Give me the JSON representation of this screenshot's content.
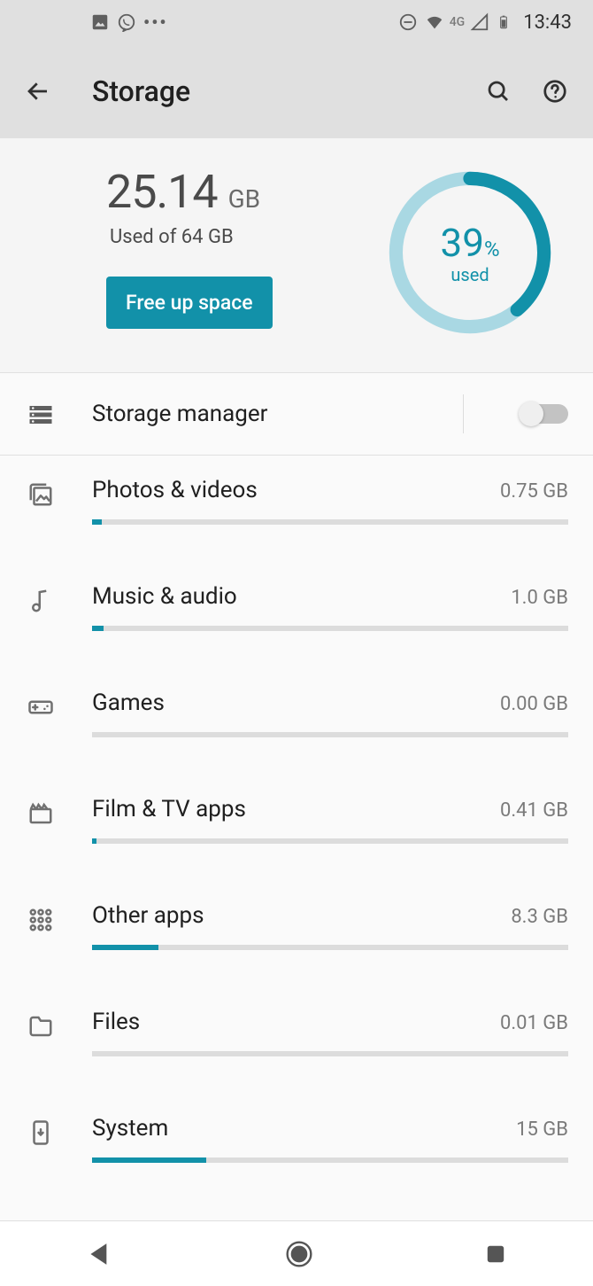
{
  "statusbar": {
    "network_label": "4G",
    "time": "13:43"
  },
  "appbar": {
    "title": "Storage"
  },
  "summary": {
    "used_value": "25.14",
    "used_unit": "GB",
    "used_of": "Used of 64 GB",
    "free_up_label": "Free up space",
    "donut_pct": "39",
    "donut_pct_sym": "%",
    "donut_used_label": "used"
  },
  "storage_manager": {
    "label": "Storage manager",
    "enabled": false
  },
  "categories": [
    {
      "id": "photos",
      "name": "Photos & videos",
      "value": "0.75 GB",
      "fill_pct": 2
    },
    {
      "id": "music",
      "name": "Music & audio",
      "value": "1.0 GB",
      "fill_pct": 2.5
    },
    {
      "id": "games",
      "name": "Games",
      "value": "0.00 GB",
      "fill_pct": 0
    },
    {
      "id": "film",
      "name": "Film & TV apps",
      "value": "0.41 GB",
      "fill_pct": 1
    },
    {
      "id": "other-apps",
      "name": "Other apps",
      "value": "8.3 GB",
      "fill_pct": 14
    },
    {
      "id": "files",
      "name": "Files",
      "value": "0.01 GB",
      "fill_pct": 0
    },
    {
      "id": "system",
      "name": "System",
      "value": "15 GB",
      "fill_pct": 24
    }
  ],
  "colors": {
    "accent": "#1291a9"
  }
}
